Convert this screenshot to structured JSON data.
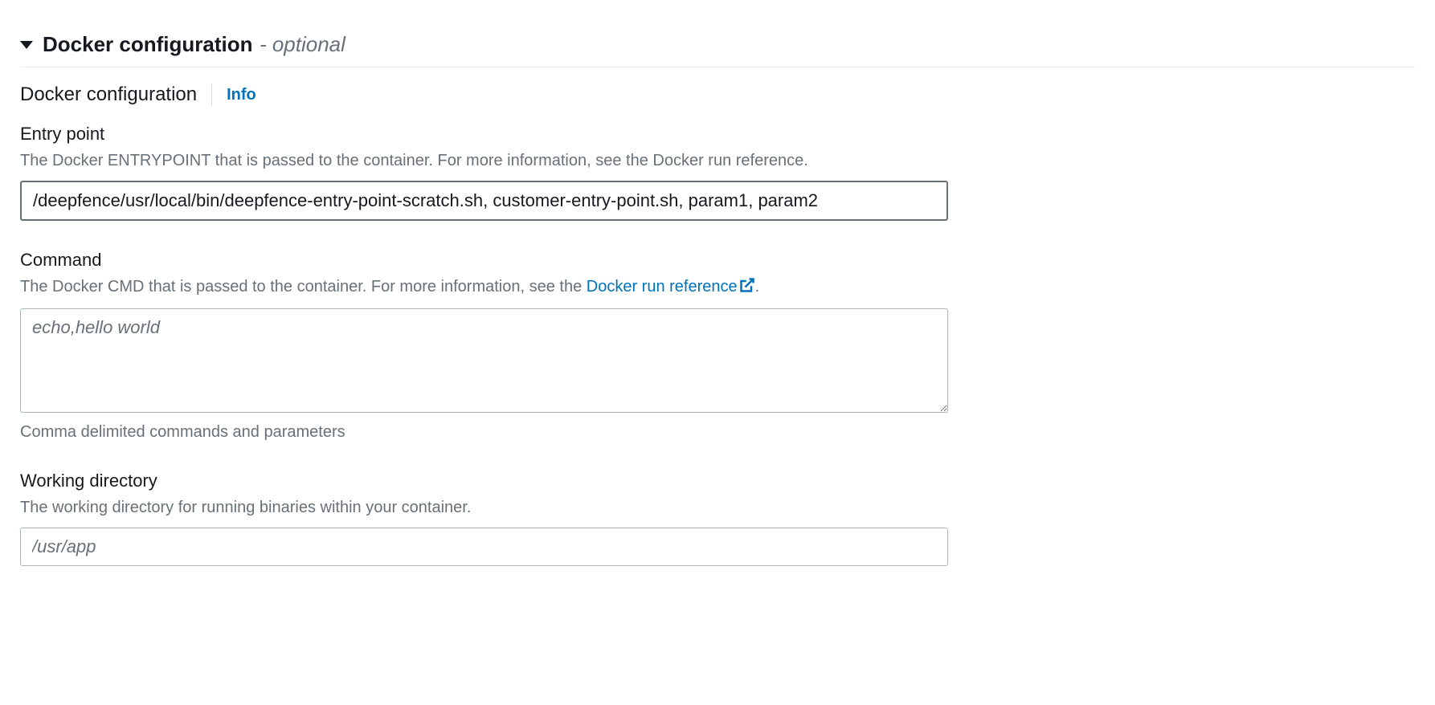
{
  "section": {
    "title": "Docker configuration",
    "suffix": "- optional"
  },
  "subsection": {
    "title": "Docker configuration",
    "info_label": "Info"
  },
  "entry_point": {
    "label": "Entry point",
    "desc": "The Docker ENTRYPOINT that is passed to the container. For more information, see the Docker run reference.",
    "value": "/deepfence/usr/local/bin/deepfence-entry-point-scratch.sh, customer-entry-point.sh, param1, param2"
  },
  "command": {
    "label": "Command",
    "desc_prefix": "The Docker CMD that is passed to the container. For more information, see the ",
    "link_text": "Docker run reference",
    "desc_suffix": ".",
    "placeholder": "echo,hello world",
    "hint": "Comma delimited commands and parameters"
  },
  "working_directory": {
    "label": "Working directory",
    "desc": "The working directory for running binaries within your container.",
    "placeholder": "/usr/app"
  }
}
